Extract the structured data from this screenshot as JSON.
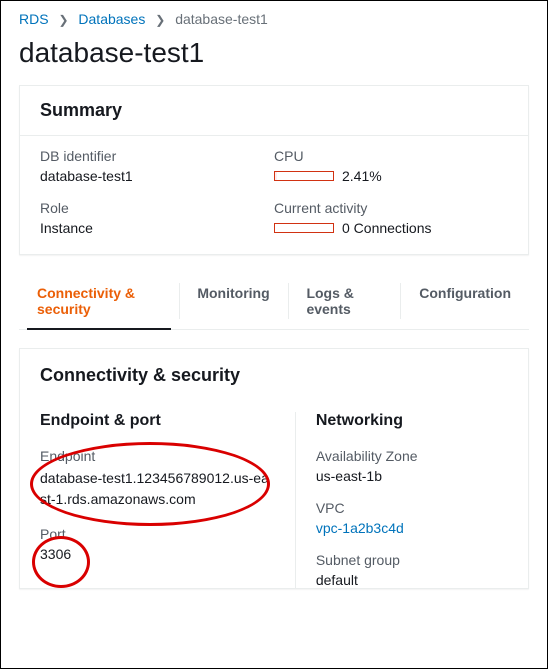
{
  "breadcrumb": {
    "root": "RDS",
    "databases": "Databases",
    "current": "database-test1"
  },
  "page_title": "database-test1",
  "summary": {
    "header": "Summary",
    "db_identifier_label": "DB identifier",
    "db_identifier_value": "database-test1",
    "role_label": "Role",
    "role_value": "Instance",
    "cpu_label": "CPU",
    "cpu_value": "2.41%",
    "activity_label": "Current activity",
    "activity_value": "0 Connections"
  },
  "tabs": {
    "connectivity": "Connectivity & security",
    "monitoring": "Monitoring",
    "logs": "Logs & events",
    "configuration": "Configuration"
  },
  "connectivity": {
    "header": "Connectivity & security",
    "endpoint_port_header": "Endpoint & port",
    "endpoint_label": "Endpoint",
    "endpoint_value": "database-test1.123456789012.us-east-1.rds.amazonaws.com",
    "port_label": "Port",
    "port_value": "3306",
    "networking_header": "Networking",
    "az_label": "Availability Zone",
    "az_value": "us-east-1b",
    "vpc_label": "VPC",
    "vpc_value": "vpc-1a2b3c4d",
    "subnet_label": "Subnet group",
    "subnet_value": "default"
  }
}
